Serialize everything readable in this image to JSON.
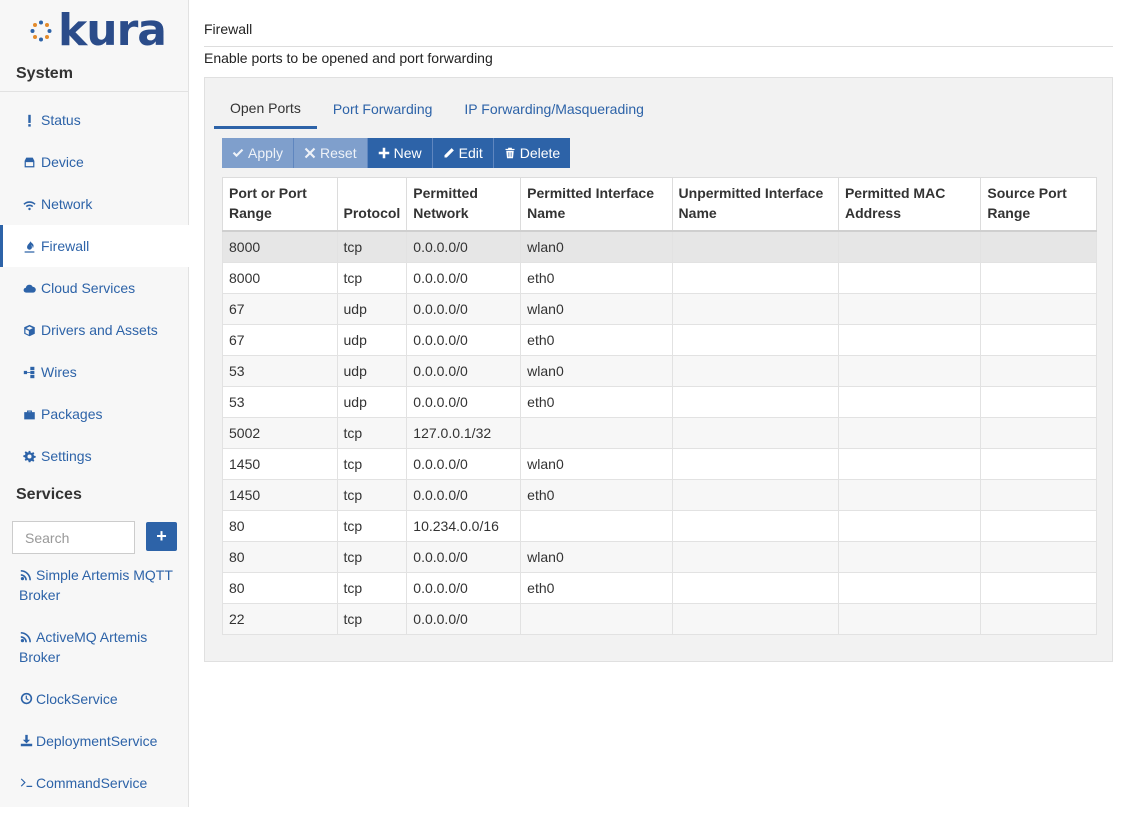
{
  "app": {
    "logo_text": "kura"
  },
  "sidebar": {
    "system_title": "System",
    "items": [
      {
        "label": "Status",
        "icon": "exclamation-icon"
      },
      {
        "label": "Device",
        "icon": "device-icon"
      },
      {
        "label": "Network",
        "icon": "wifi-icon"
      },
      {
        "label": "Firewall",
        "icon": "fire-icon",
        "active": true
      },
      {
        "label": "Cloud Services",
        "icon": "cloud-icon"
      },
      {
        "label": "Drivers and Assets",
        "icon": "cube-icon"
      },
      {
        "label": "Wires",
        "icon": "wires-icon"
      },
      {
        "label": "Packages",
        "icon": "briefcase-icon"
      },
      {
        "label": "Settings",
        "icon": "gear-icon"
      }
    ],
    "services_title": "Services",
    "search_placeholder": "Search",
    "add_label": "+",
    "services": [
      {
        "label": "Simple Artemis MQTT Broker",
        "icon": "rss-icon"
      },
      {
        "label": "ActiveMQ Artemis Broker",
        "icon": "rss-icon"
      },
      {
        "label": "ClockService",
        "icon": "clock-icon"
      },
      {
        "label": "DeploymentService",
        "icon": "download-icon"
      },
      {
        "label": "CommandService",
        "icon": "terminal-icon"
      }
    ]
  },
  "main": {
    "title": "Firewall",
    "description": "Enable ports to be opened and port forwarding",
    "tabs": [
      "Open Ports",
      "Port Forwarding",
      "IP Forwarding/Masquerading"
    ],
    "toolbar": {
      "apply": "Apply",
      "reset": "Reset",
      "new": "New",
      "edit": "Edit",
      "delete": "Delete"
    },
    "columns": [
      "Port or Port Range",
      "Protocol",
      "Permitted Network",
      "Permitted Interface Name",
      "Unpermitted Interface Name",
      "Permitted MAC Address",
      "Source Port Range"
    ],
    "rows": [
      [
        "8000",
        "tcp",
        "0.0.0.0/0",
        "wlan0",
        "",
        "",
        ""
      ],
      [
        "8000",
        "tcp",
        "0.0.0.0/0",
        "eth0",
        "",
        "",
        ""
      ],
      [
        "67",
        "udp",
        "0.0.0.0/0",
        "wlan0",
        "",
        "",
        ""
      ],
      [
        "67",
        "udp",
        "0.0.0.0/0",
        "eth0",
        "",
        "",
        ""
      ],
      [
        "53",
        "udp",
        "0.0.0.0/0",
        "wlan0",
        "",
        "",
        ""
      ],
      [
        "53",
        "udp",
        "0.0.0.0/0",
        "eth0",
        "",
        "",
        ""
      ],
      [
        "5002",
        "tcp",
        "127.0.0.1/32",
        "",
        "",
        "",
        ""
      ],
      [
        "1450",
        "tcp",
        "0.0.0.0/0",
        "wlan0",
        "",
        "",
        ""
      ],
      [
        "1450",
        "tcp",
        "0.0.0.0/0",
        "eth0",
        "",
        "",
        ""
      ],
      [
        "80",
        "tcp",
        "10.234.0.0/16",
        "",
        "",
        "",
        ""
      ],
      [
        "80",
        "tcp",
        "0.0.0.0/0",
        "wlan0",
        "",
        "",
        ""
      ],
      [
        "80",
        "tcp",
        "0.0.0.0/0",
        "eth0",
        "",
        "",
        ""
      ],
      [
        "22",
        "tcp",
        "0.0.0.0/0",
        "",
        "",
        "",
        ""
      ]
    ]
  }
}
